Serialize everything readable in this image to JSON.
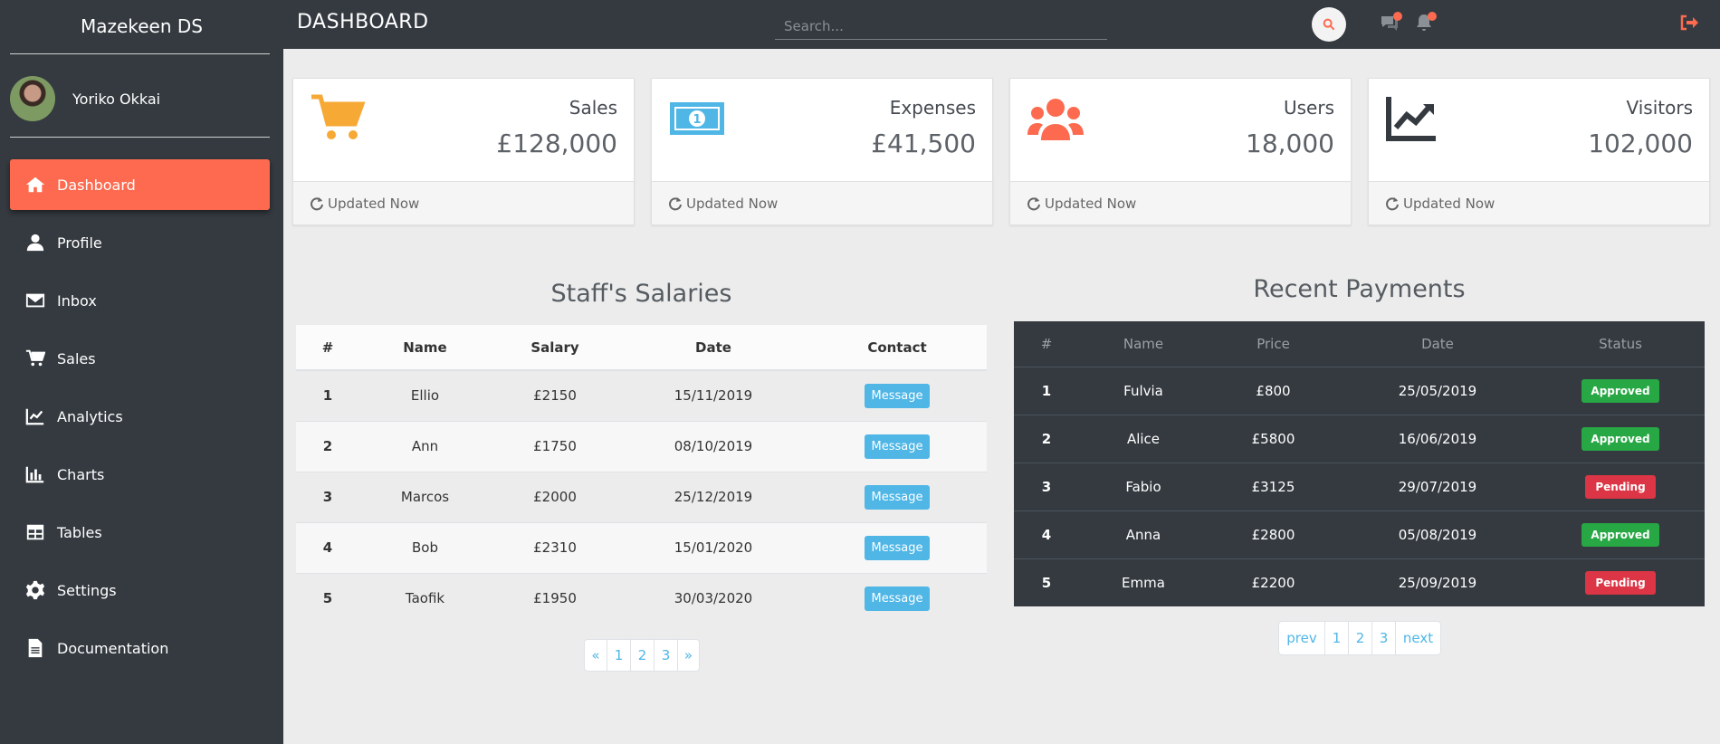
{
  "app": {
    "brand": "Mazekeen DS",
    "user_name": "Yoriko Okkai"
  },
  "colors": {
    "accent": "#fd6a4f",
    "sidebar": "#343a40",
    "approved": "#28a745",
    "pending": "#dc3545",
    "message": "#4fb6e6"
  },
  "sidebar": {
    "items": [
      {
        "label": "Dashboard",
        "icon": "home-icon",
        "active": true
      },
      {
        "label": "Profile",
        "icon": "user-icon"
      },
      {
        "label": "Inbox",
        "icon": "envelope-icon"
      },
      {
        "label": "Sales",
        "icon": "cart-icon"
      },
      {
        "label": "Analytics",
        "icon": "line-chart-icon"
      },
      {
        "label": "Charts",
        "icon": "bar-chart-icon"
      },
      {
        "label": "Tables",
        "icon": "table-icon"
      },
      {
        "label": "Settings",
        "icon": "gear-icon"
      },
      {
        "label": "Documentation",
        "icon": "document-icon"
      }
    ]
  },
  "topbar": {
    "title": "DASHBOARD",
    "search_placeholder": "Search..."
  },
  "cards": [
    {
      "label": "Sales",
      "value": "£128,000",
      "footer": "Updated Now",
      "icon": "cart-icon",
      "color": "#f6a935"
    },
    {
      "label": "Expenses",
      "value": "£41,500",
      "footer": "Updated Now",
      "icon": "money-icon",
      "color": "#4fb6e6"
    },
    {
      "label": "Users",
      "value": "18,000",
      "footer": "Updated Now",
      "icon": "users-icon",
      "color": "#fd6a4f"
    },
    {
      "label": "Visitors",
      "value": "102,000",
      "footer": "Updated Now",
      "icon": "trend-icon",
      "color": "#343a40"
    }
  ],
  "salaries": {
    "title": "Staff's Salaries",
    "headers": [
      "#",
      "Name",
      "Salary",
      "Date",
      "Contact"
    ],
    "button_label": "Message",
    "rows": [
      [
        "1",
        "Ellio",
        "£2150",
        "15/11/2019"
      ],
      [
        "2",
        "Ann",
        "£1750",
        "08/10/2019"
      ],
      [
        "3",
        "Marcos",
        "£2000",
        "25/12/2019"
      ],
      [
        "4",
        "Bob",
        "£2310",
        "15/01/2020"
      ],
      [
        "5",
        "Taofik",
        "£1950",
        "30/03/2020"
      ]
    ],
    "pagination": [
      "«",
      "1",
      "2",
      "3",
      "»"
    ]
  },
  "payments": {
    "title": "Recent Payments",
    "headers": [
      "#",
      "Name",
      "Price",
      "Date",
      "Status"
    ],
    "rows": [
      [
        "1",
        "Fulvia",
        "£800",
        "25/05/2019",
        "Approved"
      ],
      [
        "2",
        "Alice",
        "£5800",
        "16/06/2019",
        "Approved"
      ],
      [
        "3",
        "Fabio",
        "£3125",
        "29/07/2019",
        "Pending"
      ],
      [
        "4",
        "Anna",
        "£2800",
        "05/08/2019",
        "Approved"
      ],
      [
        "5",
        "Emma",
        "£2200",
        "25/09/2019",
        "Pending"
      ]
    ],
    "pagination": [
      "prev",
      "1",
      "2",
      "3",
      "next"
    ]
  }
}
